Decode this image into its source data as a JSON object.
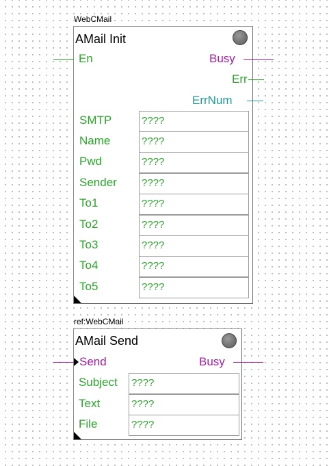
{
  "block1": {
    "instance": "WebCMail",
    "title": "AMail Init",
    "inputs": [
      {
        "label": "En"
      }
    ],
    "outputs": [
      {
        "label": "Busy"
      },
      {
        "label": "Err"
      },
      {
        "label": "ErrNum"
      }
    ],
    "params": [
      {
        "label": "SMTP",
        "value": "????"
      },
      {
        "label": "Name",
        "value": "????"
      },
      {
        "label": "Pwd",
        "value": "????"
      },
      {
        "label": "Sender",
        "value": "????"
      },
      {
        "label": "To1",
        "value": "????"
      },
      {
        "label": "To2",
        "value": "????"
      },
      {
        "label": "To3",
        "value": "????"
      },
      {
        "label": "To4",
        "value": "????"
      },
      {
        "label": "To5",
        "value": "????"
      }
    ]
  },
  "block2": {
    "instance": "ref:WebCMail",
    "title": "AMail Send",
    "inputs": [
      {
        "label": "Send"
      }
    ],
    "outputs": [
      {
        "label": "Busy"
      }
    ],
    "params": [
      {
        "label": "Subject",
        "value": "????"
      },
      {
        "label": "Text",
        "value": "????"
      },
      {
        "label": "File",
        "value": "????"
      }
    ]
  },
  "colors": {
    "bool_pin": "#2aa52a",
    "busy_pin": "#a41fa4",
    "num_pin": "#1f9a9a",
    "status_led": "#7a7a7a"
  }
}
